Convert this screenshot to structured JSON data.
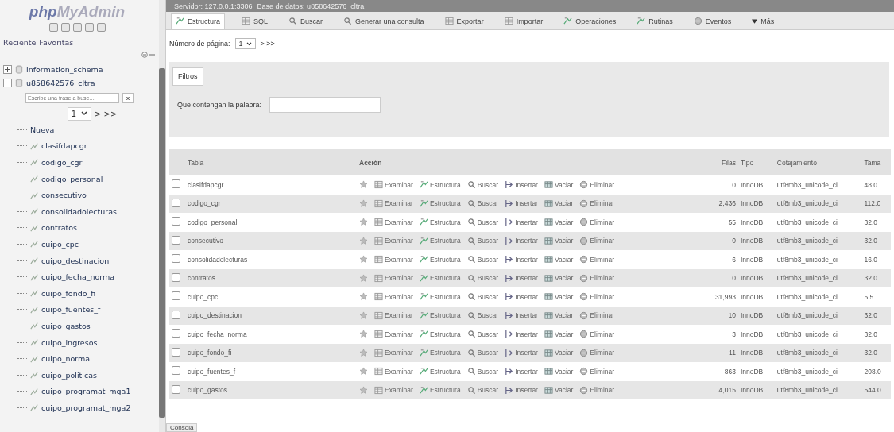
{
  "sidebar": {
    "logo": {
      "php": "php",
      "rest": "MyAdmin"
    },
    "tabs": [
      "Reciente",
      "Favoritas"
    ],
    "databases": [
      {
        "name": "information_schema",
        "expanded": false
      },
      {
        "name": "u858642576_cltra",
        "expanded": true,
        "filter": {
          "placeholder": "Escribe una frase a busc…"
        },
        "clear": "x",
        "page": "1",
        "pager": "> >>",
        "new": "Nueva",
        "tables": [
          "clasifdapcgr",
          "codigo_cgr",
          "codigo_personal",
          "consecutivo",
          "consolidadolecturas",
          "contratos",
          "cuipo_cpc",
          "cuipo_destinacion",
          "cuipo_fecha_norma",
          "cuipo_fondo_fi",
          "cuipo_fuentes_f",
          "cuipo_gastos",
          "cuipo_ingresos",
          "cuipo_norma",
          "cuipo_politicas",
          "cuipo_programat_mga1",
          "cuipo_programat_mga2"
        ]
      }
    ]
  },
  "breadcrumb": {
    "server": "Servidor: 127.0.0.1:3306",
    "database": "Base de datos: u858642576_cltra"
  },
  "tabs": [
    {
      "label": "Estructura",
      "selected": true
    },
    {
      "label": "SQL",
      "selected": false
    },
    {
      "label": "Buscar",
      "selected": false
    },
    {
      "label": "Generar una consulta",
      "selected": false
    },
    {
      "label": "Exportar",
      "selected": false
    },
    {
      "label": "Importar",
      "selected": false
    },
    {
      "label": "Operaciones",
      "selected": false
    },
    {
      "label": "Rutinas",
      "selected": false
    },
    {
      "label": "Eventos",
      "selected": false
    },
    {
      "label": "Más",
      "selected": false
    }
  ],
  "pagination": {
    "label": "Número de página:",
    "value": "1",
    "next": "> >>"
  },
  "filters": {
    "title": "Filtros",
    "label": "Que contengan la palabra:"
  },
  "table": {
    "columns": [
      "Tabla",
      "Acción",
      "Filas",
      "Tipo",
      "Cotejamiento",
      "Tama"
    ],
    "rows": [
      {
        "name": "clasifdapcgr",
        "checked": false,
        "actions": [
          "Examinar",
          "Estructura",
          "Buscar",
          "Insertar",
          "Vaciar",
          "Eliminar"
        ],
        "rows": "0",
        "engine": "InnoDB",
        "collation": "utf8mb3_unicode_ci",
        "size": "48.0"
      },
      {
        "name": "codigo_cgr",
        "checked": false,
        "actions": [
          "Examinar",
          "Estructura",
          "Buscar",
          "Insertar",
          "Vaciar",
          "Eliminar"
        ],
        "rows": "2,436",
        "engine": "InnoDB",
        "collation": "utf8mb3_unicode_ci",
        "size": "112.0"
      },
      {
        "name": "codigo_personal",
        "checked": false,
        "actions": [
          "Examinar",
          "Estructura",
          "Buscar",
          "Insertar",
          "Vaciar",
          "Eliminar"
        ],
        "rows": "55",
        "engine": "InnoDB",
        "collation": "utf8mb3_unicode_ci",
        "size": "32.0"
      },
      {
        "name": "consecutivo",
        "checked": false,
        "actions": [
          "Examinar",
          "Estructura",
          "Buscar",
          "Insertar",
          "Vaciar",
          "Eliminar"
        ],
        "rows": "0",
        "engine": "InnoDB",
        "collation": "utf8mb3_unicode_ci",
        "size": "32.0"
      },
      {
        "name": "consolidadolecturas",
        "checked": false,
        "actions": [
          "Examinar",
          "Estructura",
          "Buscar",
          "Insertar",
          "Vaciar",
          "Eliminar"
        ],
        "rows": "6",
        "engine": "InnoDB",
        "collation": "utf8mb3_unicode_ci",
        "size": "16.0"
      },
      {
        "name": "contratos",
        "checked": false,
        "actions": [
          "Examinar",
          "Estructura",
          "Buscar",
          "Insertar",
          "Vaciar",
          "Eliminar"
        ],
        "rows": "0",
        "engine": "InnoDB",
        "collation": "utf8mb3_unicode_ci",
        "size": "32.0"
      },
      {
        "name": "cuipo_cpc",
        "checked": false,
        "actions": [
          "Examinar",
          "Estructura",
          "Buscar",
          "Insertar",
          "Vaciar",
          "Eliminar"
        ],
        "rows": "31,993",
        "engine": "InnoDB",
        "collation": "utf8mb3_unicode_ci",
        "size": "5.5"
      },
      {
        "name": "cuipo_destinacion",
        "checked": false,
        "actions": [
          "Examinar",
          "Estructura",
          "Buscar",
          "Insertar",
          "Vaciar",
          "Eliminar"
        ],
        "rows": "10",
        "engine": "InnoDB",
        "collation": "utf8mb3_unicode_ci",
        "size": "32.0"
      },
      {
        "name": "cuipo_fecha_norma",
        "checked": false,
        "actions": [
          "Examinar",
          "Estructura",
          "Buscar",
          "Insertar",
          "Vaciar",
          "Eliminar"
        ],
        "rows": "3",
        "engine": "InnoDB",
        "collation": "utf8mb3_unicode_ci",
        "size": "32.0"
      },
      {
        "name": "cuipo_fondo_fi",
        "checked": false,
        "actions": [
          "Examinar",
          "Estructura",
          "Buscar",
          "Insertar",
          "Vaciar",
          "Eliminar"
        ],
        "rows": "11",
        "engine": "InnoDB",
        "collation": "utf8mb3_unicode_ci",
        "size": "32.0"
      },
      {
        "name": "cuipo_fuentes_f",
        "checked": false,
        "actions": [
          "Examinar",
          "Estructura",
          "Buscar",
          "Insertar",
          "Vaciar",
          "Eliminar"
        ],
        "rows": "863",
        "engine": "InnoDB",
        "collation": "utf8mb3_unicode_ci",
        "size": "208.0"
      },
      {
        "name": "cuipo_gastos",
        "checked": false,
        "actions": [
          "Examinar",
          "Estructura",
          "Buscar",
          "Insertar",
          "Vaciar",
          "Eliminar"
        ],
        "rows": "4,015",
        "engine": "InnoDB",
        "collation": "utf8mb3_unicode_ci",
        "size": "544.0"
      }
    ]
  },
  "console": "Consola"
}
